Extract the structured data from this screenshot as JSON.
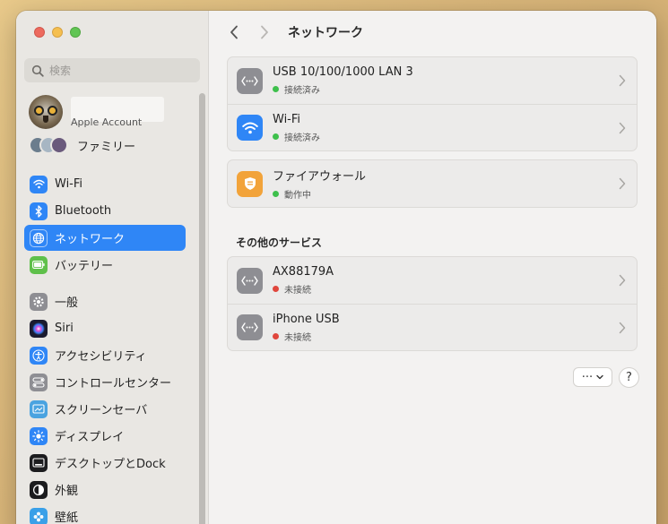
{
  "sidebar": {
    "search_placeholder": "検索",
    "account_label": "Apple Account",
    "family_label": "ファミリー",
    "items": [
      {
        "label": "Wi-Fi",
        "icon": "wifi-icon",
        "color": "#2f86f6"
      },
      {
        "label": "Bluetooth",
        "icon": "bluetooth-icon",
        "color": "#2f86f6"
      },
      {
        "label": "ネットワーク",
        "icon": "globe-icon",
        "color": "#2f86f6"
      },
      {
        "label": "バッテリー",
        "icon": "battery-icon",
        "color": "#5fc04a"
      },
      {
        "label": "一般",
        "icon": "gear-icon",
        "color": "#8e8e93"
      },
      {
        "label": "Siri",
        "icon": "siri-icon",
        "color": "#1b1b2f"
      },
      {
        "label": "アクセシビリティ",
        "icon": "accessibility-icon",
        "color": "#2f86f6"
      },
      {
        "label": "コントロールセンター",
        "icon": "control-center-icon",
        "color": "#8e8e93"
      },
      {
        "label": "スクリーンセーバ",
        "icon": "screensaver-icon",
        "color": "#4aa3e0"
      },
      {
        "label": "ディスプレイ",
        "icon": "display-icon",
        "color": "#2f86f6"
      },
      {
        "label": "デスクトップとDock",
        "icon": "dock-icon",
        "color": "#1c1c1e"
      },
      {
        "label": "外観",
        "icon": "appearance-icon",
        "color": "#1c1c1e"
      },
      {
        "label": "壁紙",
        "icon": "wallpaper-icon",
        "color": "#3aa0e8"
      }
    ]
  },
  "main": {
    "title": "ネットワーク",
    "groups": [
      [
        {
          "title": "USB 10/100/1000 LAN 3",
          "status": "接続済み",
          "status_color": "#3ec04c",
          "icon": "ethernet-icon",
          "icon_bg": "#8e8e93"
        },
        {
          "title": "Wi-Fi",
          "status": "接続済み",
          "status_color": "#3ec04c",
          "icon": "wifi-icon",
          "icon_bg": "#2f86f6"
        }
      ],
      [
        {
          "title": "ファイアウォール",
          "status": "動作中",
          "status_color": "#3ec04c",
          "icon": "firewall-icon",
          "icon_bg": "#f2a33a"
        }
      ],
      [
        {
          "title": "AX88179A",
          "status": "未接続",
          "status_color": "#e0463c",
          "icon": "ethernet-icon",
          "icon_bg": "#8e8e93"
        },
        {
          "title": "iPhone USB",
          "status": "未接続",
          "status_color": "#e0463c",
          "icon": "ethernet-icon",
          "icon_bg": "#8e8e93"
        }
      ]
    ],
    "other_services_title": "その他のサービス",
    "more_label": "···",
    "help_label": "?"
  }
}
